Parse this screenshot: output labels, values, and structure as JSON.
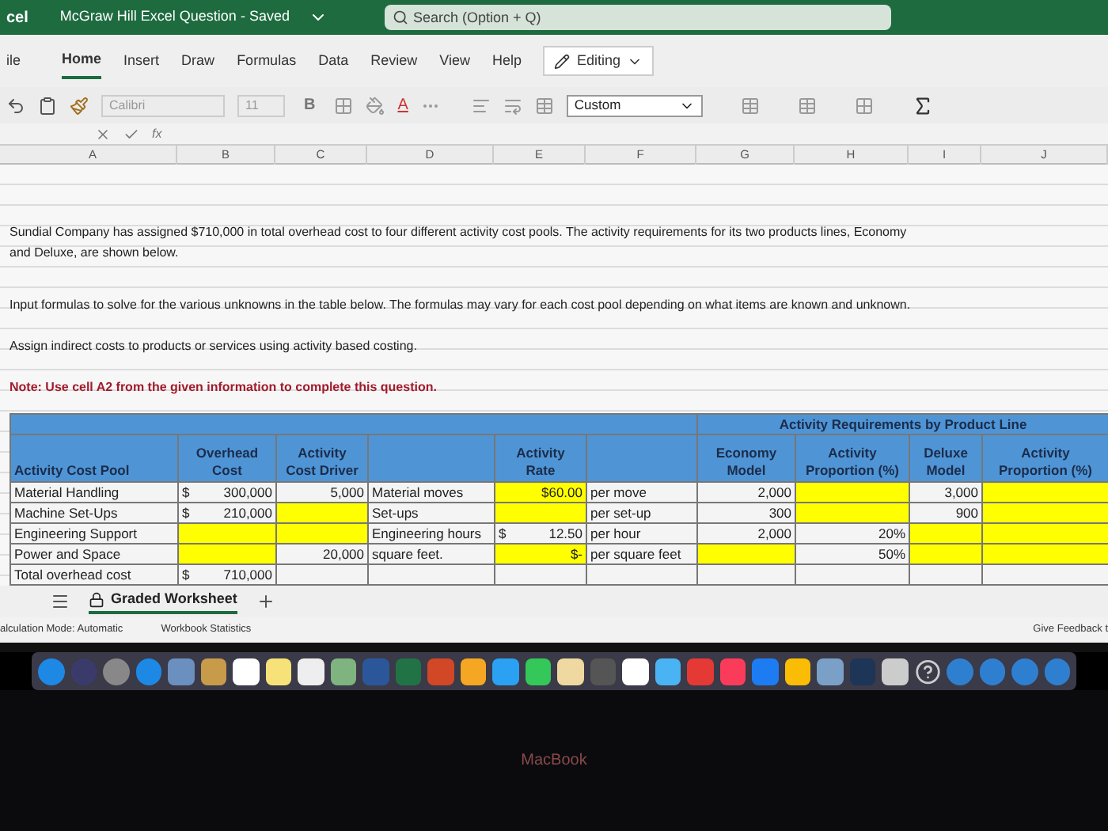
{
  "title_bar": {
    "app": "cel",
    "document": "McGraw Hill Excel Question",
    "separator": "-",
    "status": "Saved",
    "search": {
      "placeholder": "Search (Option + Q)"
    }
  },
  "tabs": [
    {
      "label": "ile",
      "selected": false
    },
    {
      "label": "Home",
      "selected": true
    },
    {
      "label": "Insert",
      "selected": false
    },
    {
      "label": "Draw",
      "selected": false
    },
    {
      "label": "Formulas",
      "selected": false
    },
    {
      "label": "Data",
      "selected": false
    },
    {
      "label": "Review",
      "selected": false
    },
    {
      "label": "View",
      "selected": false
    },
    {
      "label": "Help",
      "selected": false
    }
  ],
  "editing_button": "Editing",
  "toolbar": {
    "font": "Calibri",
    "size": "11",
    "bold": "B",
    "font_color": "A",
    "number_format": "Custom"
  },
  "formula_bar": {
    "function_label": "fx"
  },
  "columns": [
    "A",
    "B",
    "C",
    "D",
    "E",
    "F",
    "G",
    "H",
    "I",
    "J"
  ],
  "paragraphs": [
    {
      "text": "Sundial Company has assigned $710,000 in total overhead cost to four different activity cost pools.  The activity requirements for its two products lines, Economy and Deluxe, are shown below.",
      "kind": "plain"
    },
    {
      "text": "Input formulas to solve for the various unknowns in the table below. The formulas may vary for each cost pool depending on what items are known and unknown.",
      "kind": "plain"
    },
    {
      "text": "Assign indirect costs to products or services using activity based costing.",
      "kind": "plain"
    },
    {
      "text": "Note: Use cell A2 from the given information to complete this question.",
      "kind": "note"
    }
  ],
  "table": {
    "group_header": "Activity Requirements by Product Line",
    "headers": [
      {
        "kind": "label",
        "lines": [
          "Activity Cost Pool"
        ]
      },
      {
        "kind": "label",
        "lines": [
          "Overhead",
          "Cost"
        ]
      },
      {
        "kind": "label",
        "lines": [
          "Activity",
          "Cost Driver"
        ]
      },
      {
        "kind": "blank"
      },
      {
        "kind": "label",
        "lines": [
          "Activity",
          "Rate"
        ]
      },
      {
        "kind": "blank"
      },
      {
        "kind": "label",
        "lines": [
          "Economy",
          "Model"
        ]
      },
      {
        "kind": "label",
        "lines": [
          "Activity",
          "Proportion (%)"
        ]
      },
      {
        "kind": "label",
        "lines": [
          "Deluxe",
          "Model"
        ]
      },
      {
        "kind": "label",
        "lines": [
          "Activity",
          "Proportion (%)"
        ]
      }
    ],
    "rows": [
      {
        "cells": [
          {
            "text": "Material Handling",
            "kind": "text",
            "input": false
          },
          {
            "currency": "$",
            "text": "300,000",
            "kind": "number",
            "input": false
          },
          {
            "text": "5,000",
            "kind": "number",
            "input": false
          },
          {
            "text": "Material moves",
            "kind": "text",
            "input": false
          },
          {
            "text": "$60.00",
            "kind": "number",
            "input": true
          },
          {
            "text": "per move",
            "kind": "text",
            "input": false
          },
          {
            "text": "2,000",
            "kind": "number",
            "input": false
          },
          {
            "input": true
          },
          {
            "text": "3,000",
            "kind": "number",
            "input": false
          },
          {
            "input": true
          }
        ]
      },
      {
        "cells": [
          {
            "text": "Machine Set-Ups",
            "kind": "text",
            "input": false
          },
          {
            "currency": "$",
            "text": "210,000",
            "kind": "number",
            "input": false
          },
          {
            "input": true
          },
          {
            "text": "Set-ups",
            "kind": "text",
            "input": false
          },
          {
            "input": true
          },
          {
            "text": "per set-up",
            "kind": "text",
            "input": false
          },
          {
            "text": "300",
            "kind": "number",
            "input": false
          },
          {
            "input": true
          },
          {
            "text": "900",
            "kind": "number",
            "input": false
          },
          {
            "input": true
          }
        ]
      },
      {
        "cells": [
          {
            "text": "Engineering Support",
            "kind": "text",
            "input": false
          },
          {
            "input": true
          },
          {
            "input": true
          },
          {
            "text": "Engineering hours",
            "kind": "text",
            "input": false
          },
          {
            "currency": "$",
            "text": "12.50",
            "kind": "number",
            "input": false
          },
          {
            "text": "per hour",
            "kind": "text",
            "input": false
          },
          {
            "text": "2,000",
            "kind": "number",
            "input": false
          },
          {
            "text": "20%",
            "kind": "number",
            "input": false
          },
          {
            "input": true
          },
          {
            "input": true
          }
        ]
      },
      {
        "cells": [
          {
            "text": "Power and Space",
            "kind": "text",
            "input": false
          },
          {
            "input": true
          },
          {
            "text": "20,000",
            "kind": "number",
            "input": false
          },
          {
            "text": "square feet.",
            "kind": "text",
            "input": false
          },
          {
            "text": "$-",
            "kind": "number",
            "input": true
          },
          {
            "text": "per square feet",
            "kind": "text",
            "input": false
          },
          {
            "input": true
          },
          {
            "text": "50%",
            "kind": "number",
            "input": false
          },
          {
            "input": true
          },
          {
            "input": true
          }
        ]
      },
      {
        "cells": [
          {
            "text": "Total overhead cost",
            "kind": "text",
            "input": false
          },
          {
            "currency": "$",
            "text": "710,000",
            "kind": "number",
            "input": false
          },
          {
            "input": false
          },
          {
            "input": false
          },
          {
            "input": false
          },
          {
            "input": false
          },
          {
            "input": false
          },
          {
            "input": false
          },
          {
            "input": false
          },
          {
            "input": false
          }
        ]
      }
    ]
  },
  "sheet_tabs": [
    {
      "label": "Graded Worksheet",
      "selected": true
    }
  ],
  "status_bar": {
    "left": [
      "alculation Mode: Automatic",
      "Workbook Statistics"
    ],
    "right": "Give Feedback t"
  },
  "bezel_label": "MacBook"
}
